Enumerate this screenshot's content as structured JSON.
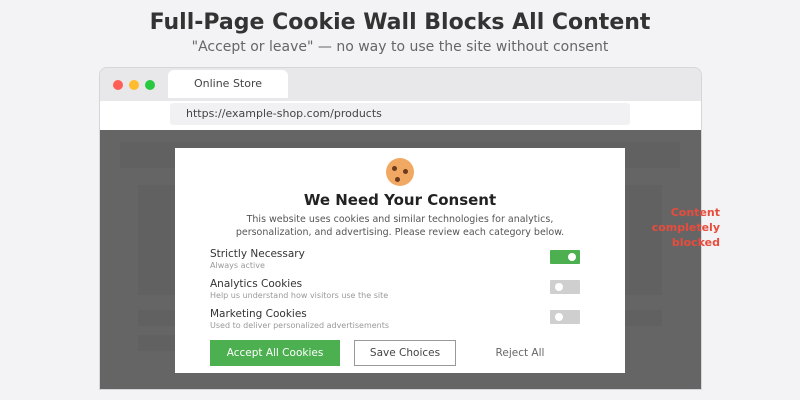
{
  "header": {
    "title": "Full-Page Cookie Wall Blocks All Content",
    "subtitle": "\"Accept or leave\" — no way to use the site without consent"
  },
  "browser": {
    "tab_label": "Online Store",
    "url": "https://example-shop.com/products"
  },
  "modal": {
    "icon": "cookie-icon",
    "title": "We Need Your Consent",
    "description": "This website uses cookies and similar technologies for analytics, personalization, and advertising. Please review each category below.",
    "categories": [
      {
        "label": "Strictly Necessary",
        "sublabel": "Always active",
        "enabled": true
      },
      {
        "label": "Analytics Cookies",
        "sublabel": "Help us understand how visitors use the site",
        "enabled": false
      },
      {
        "label": "Marketing Cookies",
        "sublabel": "Used to deliver personalized advertisements",
        "enabled": false
      }
    ],
    "buttons": {
      "accept": "Accept All Cookies",
      "save": "Save Choices",
      "reject": "Reject All"
    }
  },
  "annotation": {
    "text": "Content completely blocked"
  },
  "colors": {
    "accent_green": "#4caf50",
    "annotation_red": "#e74c3c",
    "overlay": "#3c3c3c"
  }
}
